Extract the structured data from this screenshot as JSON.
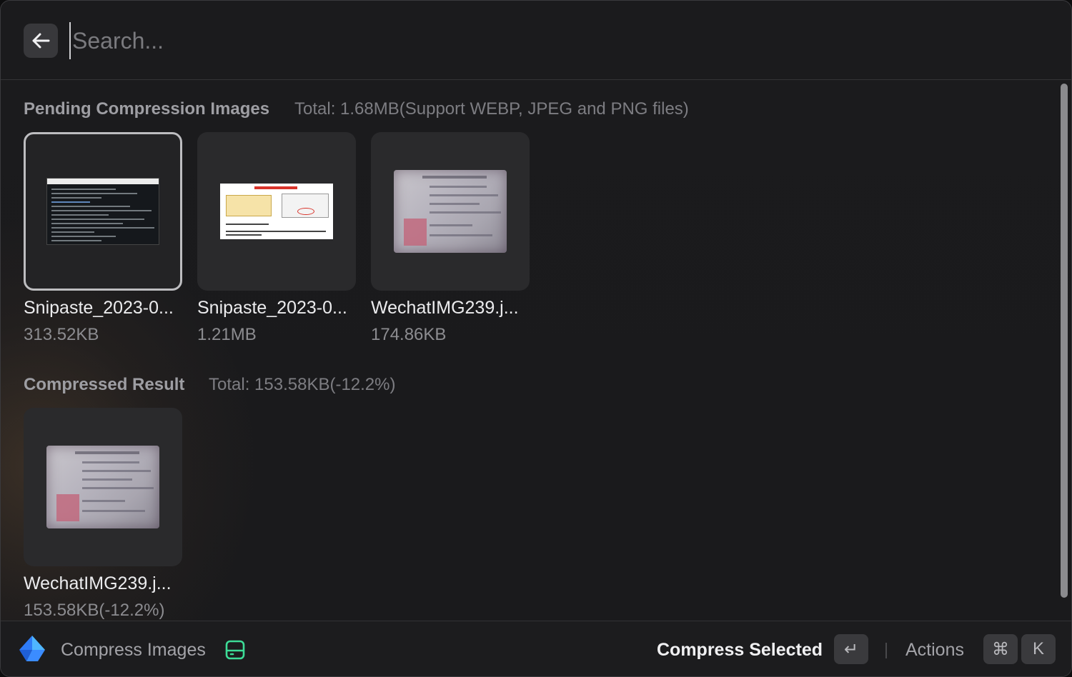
{
  "search": {
    "placeholder": "Search..."
  },
  "pending": {
    "title": "Pending Compression Images",
    "total": "Total: 1.68MB(Support WEBP, JPEG and PNG files)",
    "items": [
      {
        "name": "Snipaste_2023-0...",
        "size": "313.52KB",
        "thumb": "terminal-screenshot",
        "selected": true
      },
      {
        "name": "Snipaste_2023-0...",
        "size": "1.21MB",
        "thumb": "diagram-screenshot",
        "selected": false
      },
      {
        "name": "WechatIMG239.j...",
        "size": "174.86KB",
        "thumb": "license-card-photo",
        "selected": false
      }
    ]
  },
  "compressed": {
    "title": "Compressed Result",
    "total": "Total: 153.58KB(-12.2%)",
    "items": [
      {
        "name": "WechatIMG239.j...",
        "size": "153.58KB(-12.2%)",
        "thumb": "license-card-photo"
      }
    ]
  },
  "footer": {
    "app_name": "Compress Images",
    "primary_action": "Compress Selected",
    "enter_key": "↵",
    "actions_label": "Actions",
    "cmd_key": "⌘",
    "k_key": "K"
  },
  "colors": {
    "background": "#1b1b1d",
    "accent_storage": "#3ddc97",
    "app_icon_blue": "#2f7bf6"
  },
  "icons": [
    "arrow-left-icon",
    "app-logo-icon",
    "storage-drive-icon"
  ]
}
